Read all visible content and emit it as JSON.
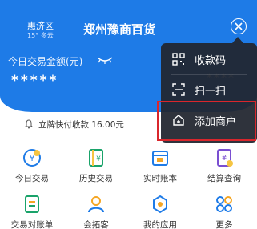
{
  "header": {
    "district": "惠济区",
    "weather": "15° 多云",
    "store_name": "郑州豫商百货",
    "balance_label": "今日交易金额(元)",
    "masked_amount": "*****",
    "masked_amount_2": "****"
  },
  "notice": {
    "text": "立牌快付收款 16.00元"
  },
  "grid": {
    "items": [
      {
        "label": "今日交易",
        "icon": "yuan-clock-icon",
        "color": "#1e7be7"
      },
      {
        "label": "历史交易",
        "icon": "yuan-book-icon",
        "color": "#1aa36a"
      },
      {
        "label": "实时账本",
        "icon": "calendar-icon",
        "color": "#1e7be7"
      },
      {
        "label": "结算查询",
        "icon": "yuan-check-icon",
        "color": "#7a4fd1"
      },
      {
        "label": "交易对账单",
        "icon": "ledger-icon",
        "color": "#1aa36a"
      },
      {
        "label": "会拓客",
        "icon": "user-icon",
        "color": "#f5a623"
      },
      {
        "label": "我的应用",
        "icon": "app-icon",
        "color": "#1e7be7"
      },
      {
        "label": "更多",
        "icon": "more-icon",
        "color": "#1e7be7"
      }
    ]
  },
  "menu": {
    "items": [
      {
        "label": "收款码",
        "icon": "qr-code-icon"
      },
      {
        "label": "扫一扫",
        "icon": "scan-icon"
      },
      {
        "label": "添加商户",
        "icon": "home-add-icon"
      }
    ]
  },
  "colors": {
    "header_blue": "#1e7be7",
    "popup_bg": "#222630",
    "highlight": "#d9262c"
  }
}
